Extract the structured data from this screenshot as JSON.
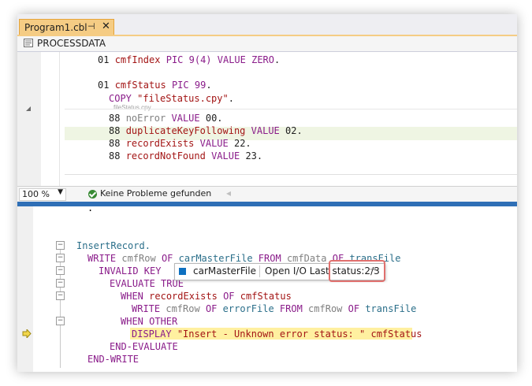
{
  "tab": {
    "title": "Program1.cbl",
    "pin": "⊣",
    "close": "✕"
  },
  "nav": {
    "label": "PROCESSDATA"
  },
  "pane1": {
    "line1": {
      "level": "01",
      "name": "cmfIndex",
      "pic": "PIC 9(4)",
      "value_kw": "VALUE",
      "zero": "ZERO",
      "dot": "."
    },
    "line2": {
      "level": "01",
      "name": "cmfStatus",
      "pic": "PIC 99",
      "dot": "."
    },
    "copy": {
      "kw": "COPY",
      "file": "\"fileStatus.cpy\"",
      "dot": "."
    },
    "hint": "fileStatus.cpy",
    "conds": [
      {
        "level": "88",
        "name": "noError",
        "kw": "VALUE",
        "val": "00."
      },
      {
        "level": "88",
        "name": "duplicateKeyFollowing",
        "kw": "VALUE",
        "val": "02."
      },
      {
        "level": "88",
        "name": "recordExists",
        "kw": "VALUE",
        "val": "22."
      },
      {
        "level": "88",
        "name": "recordNotFound",
        "kw": "VALUE",
        "val": "23."
      }
    ]
  },
  "status": {
    "zoom": "100 %",
    "problems": "Keine Probleme gefunden"
  },
  "pane2": {
    "dot": ".",
    "para": "InsertRecord.",
    "write": {
      "kw": "WRITE",
      "rec": "cmfRow",
      "of": "OF",
      "file": "carMasterFile",
      "from": "FROM",
      "data": "cmfData",
      "of2": "OF",
      "tf": "transFile"
    },
    "invalid": "INVALID KEY",
    "evaluate": "EVALUATE TRUE",
    "when1": {
      "kw": "WHEN",
      "cond": "recordExists",
      "of": "OF",
      "st": "cmfStatus"
    },
    "write2": {
      "kw": "WRITE",
      "rec": "cmfRow",
      "of": "OF",
      "file": "errorFile",
      "from": "FROM",
      "src": "cmfRow",
      "of2": "OF",
      "tf": "transFile"
    },
    "when2": "WHEN OTHER",
    "display": {
      "kw": "DISPLAY",
      "str": "\"Insert - Unknown error status: \"",
      "var": "cmfStatus"
    },
    "endeval": "END-EVALUATE",
    "endwrite": "END-WRITE"
  },
  "tooltip": {
    "name": "carMasterFile",
    "status": "Open I/O Last status:2/3"
  },
  "colors": {
    "tab_active": "#f5cc84",
    "splitter": "#2f6fb6",
    "highlight": "#fff0a0",
    "callout": "#e0706e"
  }
}
